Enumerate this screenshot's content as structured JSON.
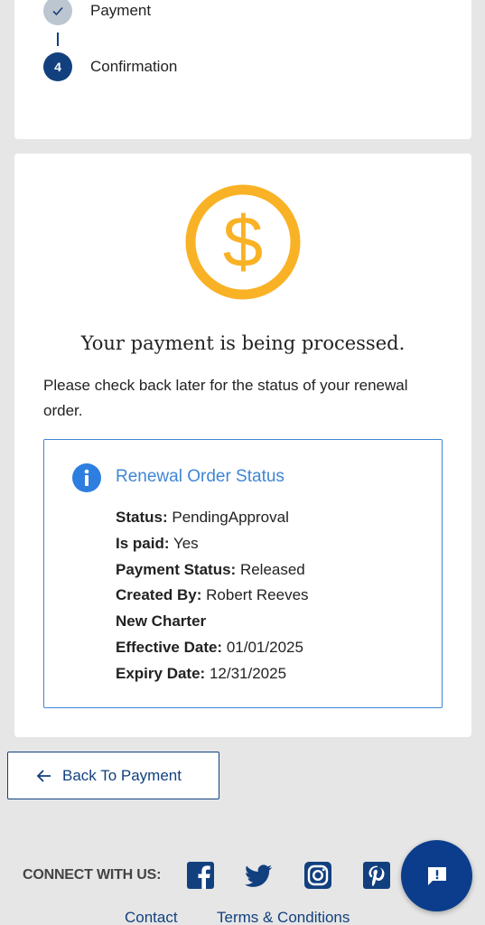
{
  "stepper": {
    "steps": [
      {
        "number": "✓",
        "label": "Payment",
        "state": "done"
      },
      {
        "number": "4",
        "label": "Confirmation",
        "state": "active"
      }
    ]
  },
  "confirmation": {
    "icon": "dollar-circle-icon",
    "icon_color": "#f9b225",
    "headline": "Your payment is being processed.",
    "message": "Please check back later for the status of your renewal order."
  },
  "order_status": {
    "title": "Renewal Order Status",
    "accent_color": "#3f86d6",
    "rows": [
      {
        "label": "Status:",
        "value": "PendingApproval"
      },
      {
        "label": "Is paid:",
        "value": "Yes"
      },
      {
        "label": "Payment Status:",
        "value": "Released"
      },
      {
        "label": "Created By:",
        "value": "Robert Reeves"
      },
      {
        "label": "New Charter",
        "value": ""
      },
      {
        "label": "Effective Date:",
        "value": "01/01/2025"
      },
      {
        "label": "Expiry Date:",
        "value": "12/31/2025"
      }
    ]
  },
  "actions": {
    "back_label": "Back To Payment"
  },
  "footer": {
    "connect_label": "CONNECT WITH US:",
    "social": [
      "facebook-icon",
      "twitter-icon",
      "instagram-icon",
      "pinterest-icon"
    ],
    "links": [
      "Contact",
      "Terms & Conditions"
    ],
    "brand_color": "#12407f"
  }
}
